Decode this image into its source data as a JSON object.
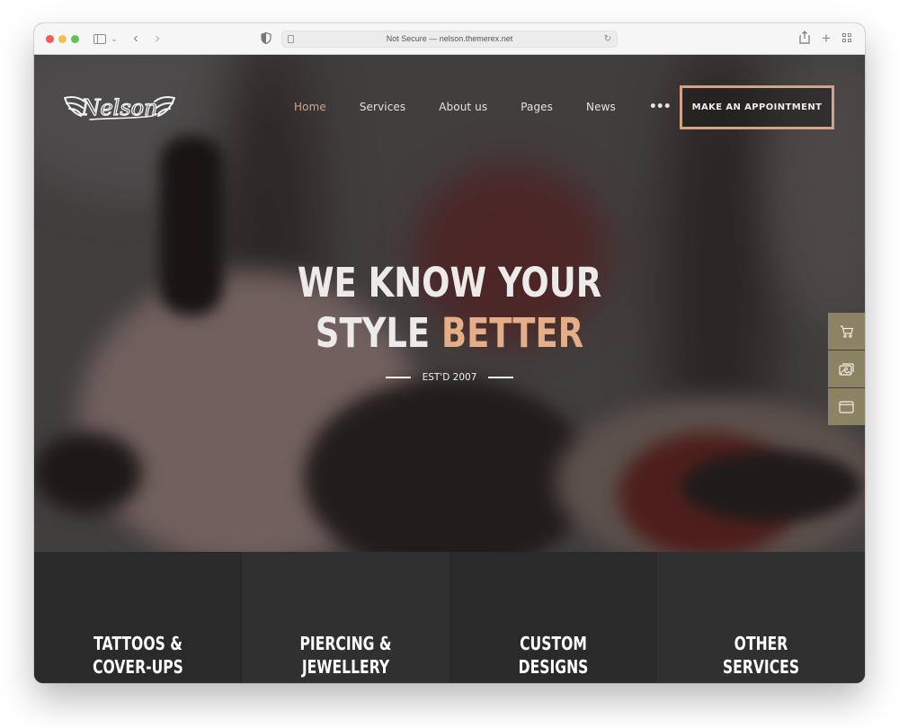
{
  "browser": {
    "url_text": "Not Secure — nelson.themerex.net",
    "icons": {
      "close": "traffic-light-red",
      "minimize": "traffic-light-yellow",
      "zoom": "traffic-light-green",
      "sidebar": "sidebar-toggle-icon",
      "back": "chevron-left-icon",
      "forward": "chevron-right-icon",
      "privacy": "shield-icon",
      "reload": "reload-icon",
      "share": "share-icon",
      "new_tab": "plus-icon",
      "tab_overview": "grid-icon"
    },
    "glyphs": {
      "back": "‹",
      "forward": "›",
      "chevron_down": "⌄",
      "reload": "↻",
      "plus": "+"
    }
  },
  "site": {
    "logo_text": "Nelson",
    "nav": [
      {
        "label": "Home",
        "active": true
      },
      {
        "label": "Services",
        "active": false
      },
      {
        "label": "About us",
        "active": false
      },
      {
        "label": "Pages",
        "active": false
      },
      {
        "label": "News",
        "active": false
      }
    ],
    "nav_more": "•••",
    "cta_label": "MAKE AN APPOINTMENT",
    "colors": {
      "accent": "#e6ae88",
      "cta_border": "#d2a386",
      "dock": "#8c8264",
      "service_bg_a": "#2a2a2a",
      "service_bg_b": "#303030"
    }
  },
  "hero": {
    "line1": "WE KNOW YOUR",
    "line2_prefix": "STYLE ",
    "line2_accent": "BETTER",
    "established": "EST'D 2007"
  },
  "side_dock": [
    {
      "icon": "cart-icon"
    },
    {
      "icon": "gallery-icon"
    },
    {
      "icon": "browser-window-icon"
    }
  ],
  "services": [
    {
      "title": "TATTOOS &\nCOVER-UPS"
    },
    {
      "title": "PIERCING &\nJEWELLERY"
    },
    {
      "title": "CUSTOM\nDESIGNS"
    },
    {
      "title": "OTHER\nSERVICES"
    }
  ]
}
